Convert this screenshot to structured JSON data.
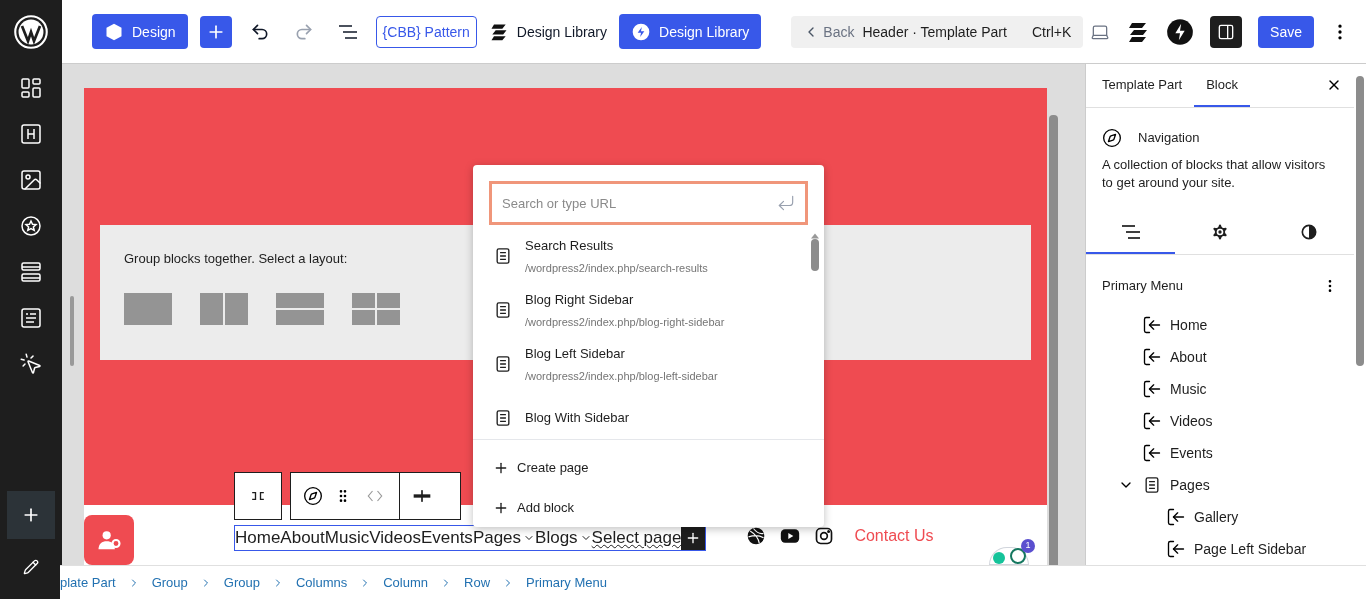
{
  "toolbar": {
    "buttons": [
      {
        "kind": "design",
        "label": "Design"
      },
      {
        "kind": "add"
      },
      {
        "kind": "undo"
      },
      {
        "kind": "redo",
        "disabled": true
      },
      {
        "kind": "outline"
      },
      {
        "kind": "pattern",
        "label": "{CBB} Pattern"
      },
      {
        "kind": "library",
        "label": "Design Library"
      },
      {
        "kind": "library-primary",
        "label": "Design Library"
      }
    ]
  },
  "command_bar": {
    "back": "Back",
    "title": "Header · Template Part",
    "shortcut": "Ctrl+K"
  },
  "save": "Save",
  "canvas": {
    "group_prompt": "Group blocks together. Select a layout:",
    "nav_items": [
      {
        "label": "Home",
        "kind": "link"
      },
      {
        "label": "About",
        "kind": "link"
      },
      {
        "label": "Music",
        "kind": "link"
      },
      {
        "label": "Videos",
        "kind": "link"
      },
      {
        "label": "Events",
        "kind": "link"
      },
      {
        "label": "Pages",
        "kind": "submenu"
      },
      {
        "label": "Blogs",
        "kind": "submenu"
      },
      {
        "label": "Select page",
        "kind": "placeholder"
      }
    ],
    "contact": "Contact Us",
    "badge_count": "1"
  },
  "link_popover": {
    "placeholder": "Search or type URL",
    "results": [
      {
        "title": "Search Results",
        "url": "/wordpress2/index.php/search-results"
      },
      {
        "title": "Blog Right Sidebar",
        "url": "/wordpress2/index.php/blog-right-sidebar"
      },
      {
        "title": "Blog Left Sidebar",
        "url": "/wordpress2/index.php/blog-left-sidebar"
      },
      {
        "title": "Blog With Sidebar"
      }
    ],
    "actions": [
      "Create page",
      "Add block"
    ]
  },
  "sidebar": {
    "tabs": [
      {
        "label": "Template Part",
        "selected": false
      },
      {
        "label": "Block",
        "selected": true
      }
    ],
    "block": {
      "name": "Navigation",
      "description": "A collection of blocks that allow visitors to get around your site."
    },
    "subtabs": [
      {
        "kind": "list",
        "selected": true
      },
      {
        "kind": "settings",
        "selected": false
      },
      {
        "kind": "styles",
        "selected": false
      }
    ],
    "menu_title": "Primary Menu",
    "tree": [
      {
        "label": "Home",
        "kind": "link"
      },
      {
        "label": "About",
        "kind": "link"
      },
      {
        "label": "Music",
        "kind": "link"
      },
      {
        "label": "Videos",
        "kind": "link"
      },
      {
        "label": "Events",
        "kind": "link"
      },
      {
        "label": "Pages",
        "kind": "submenu",
        "expanded": true,
        "children": [
          {
            "label": "Gallery",
            "kind": "link"
          },
          {
            "label": "Page Left Sidebar",
            "kind": "link"
          }
        ]
      }
    ]
  },
  "breadcrumbs": [
    "plate Part",
    "Group",
    "Group",
    "Columns",
    "Column",
    "Row",
    "Primary Menu"
  ]
}
